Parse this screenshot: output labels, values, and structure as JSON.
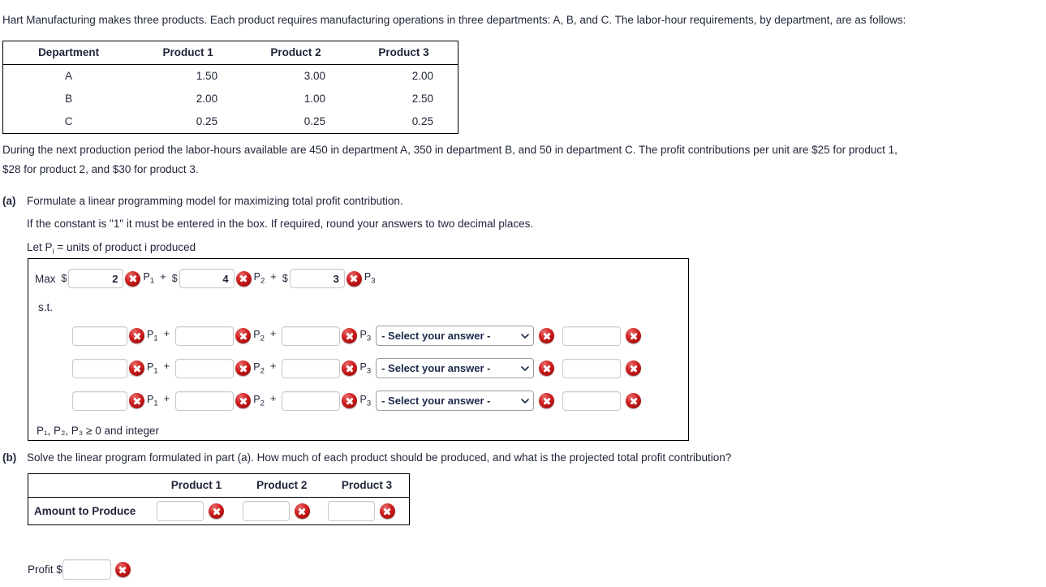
{
  "intro": {
    "paragraph": "Hart Manufacturing makes three products. Each product requires manufacturing operations in three departments: A, B, and C. The labor-hour requirements, by department, are as follows:"
  },
  "requirements_table": {
    "headers": [
      "Department",
      "Product 1",
      "Product 2",
      "Product 3"
    ],
    "rows": [
      {
        "department": "A",
        "p1": "1.50",
        "p2": "3.00",
        "p3": "2.00"
      },
      {
        "department": "B",
        "p1": "2.00",
        "p2": "1.00",
        "p3": "2.50"
      },
      {
        "department": "C",
        "p1": "0.25",
        "p2": "0.25",
        "p3": "0.25"
      }
    ]
  },
  "availability": {
    "line1": "During the next production period the labor-hours available are 450 in department A, 350 in department B, and 50 in department C. The profit contributions per unit are $25 for product 1,",
    "line2": "$28 for product 2, and $30 for product 3."
  },
  "part_a": {
    "label": "(a)",
    "prompt": "Formulate a linear programming model for maximizing total profit contribution.",
    "note": "If the constant is \"1\" it must be entered in the box. If required, round your answers to two decimal places.",
    "definition_prefix": "Let P",
    "definition_sub": "i",
    "definition_suffix": " = units of product i produced",
    "objective": {
      "max_label": "Max",
      "currency": "$",
      "plus": "+",
      "terms": [
        {
          "value": "2",
          "var": "P",
          "sub": "1"
        },
        {
          "value": "4",
          "var": "P",
          "sub": "2"
        },
        {
          "value": "3",
          "var": "P",
          "sub": "3"
        }
      ]
    },
    "st_label": "s.t.",
    "select_placeholder": "- Select your answer -",
    "constraints": [
      {
        "c1": "",
        "c2": "",
        "c3": "",
        "relation": "- Select your answer -",
        "rhs": ""
      },
      {
        "c1": "",
        "c2": "",
        "c3": "",
        "relation": "- Select your answer -",
        "rhs": ""
      },
      {
        "c1": "",
        "c2": "",
        "c3": "",
        "relation": "- Select your answer -",
        "rhs": ""
      }
    ],
    "term_vars": [
      {
        "var": "P",
        "sub": "1"
      },
      {
        "var": "P",
        "sub": "2"
      },
      {
        "var": "P",
        "sub": "3"
      }
    ],
    "nonnegativity": "P₁, P₂, P₃ ≥ 0 and integer"
  },
  "part_b": {
    "label": "(b)",
    "prompt": "Solve the linear program formulated in part (a). How much of each product should be produced, and what is the projected total profit contribution?",
    "table": {
      "headers": [
        "",
        "Product 1",
        "Product 2",
        "Product 3"
      ],
      "row_label": "Amount to Produce",
      "values": [
        "",
        "",
        ""
      ]
    },
    "profit_label": "Profit $",
    "profit_value": ""
  },
  "icons": {
    "error": "error-x-icon",
    "chevron": "chevron-down-icon"
  },
  "colors": {
    "text": "#1f2438",
    "error_red": "#c01818",
    "select_text": "#1b2a4a",
    "border": "#000000"
  }
}
